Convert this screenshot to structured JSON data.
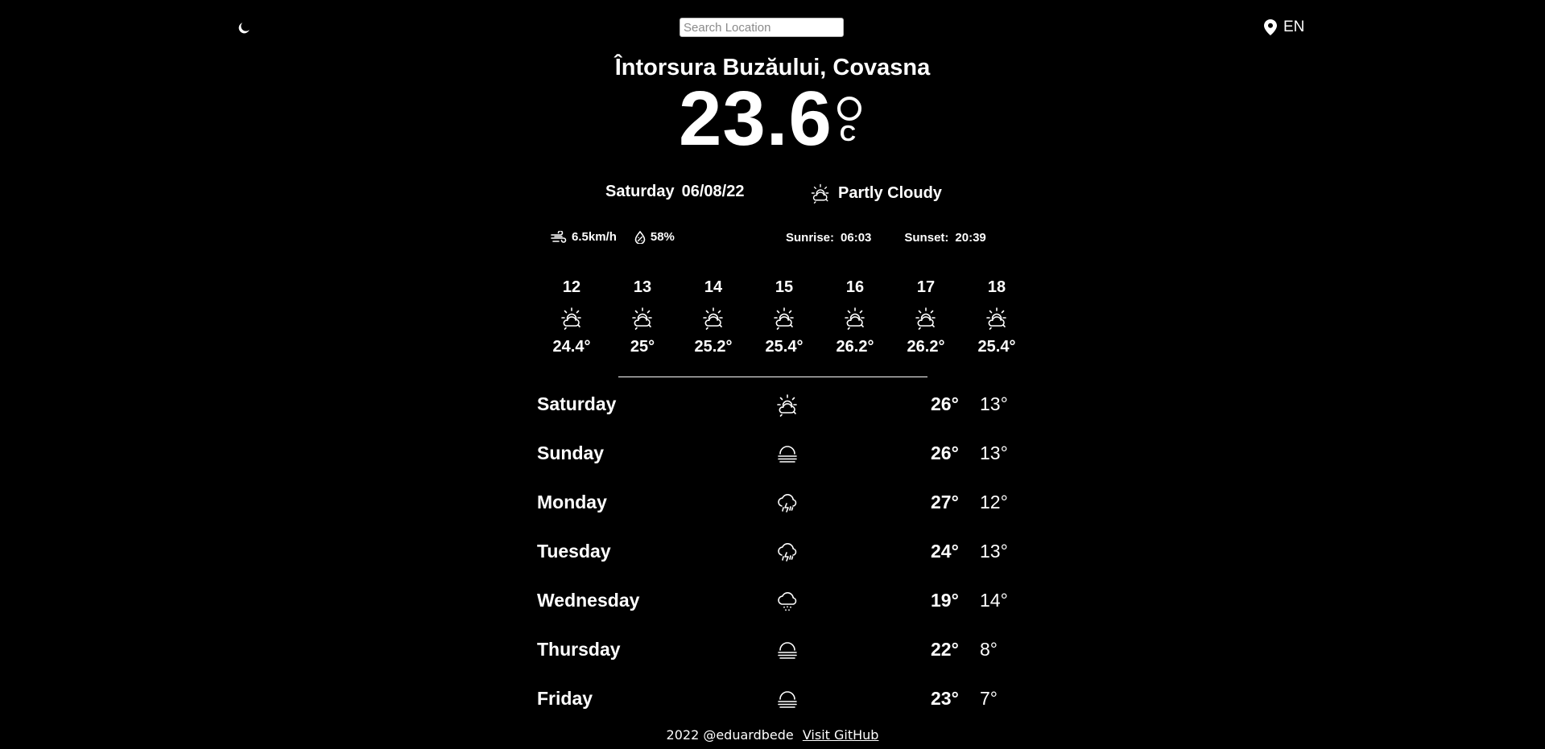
{
  "header": {
    "theme_icon": "moon-icon",
    "search_placeholder": "Search Location",
    "search_value": "",
    "locate_icon": "map-pin-icon",
    "language": "EN"
  },
  "current": {
    "location": "Întorsura Buzăului, Covasna",
    "temperature": "23.6",
    "unit": "C",
    "day": "Saturday",
    "date": "06/08/22",
    "condition_icon": "partly-cloudy-sun-icon",
    "condition": "Partly Cloudy",
    "wind_icon": "wind-icon",
    "wind": "6.5km/h",
    "humidity_icon": "humidity-drop-icon",
    "humidity": "58%",
    "sunrise_label": "Sunrise:",
    "sunrise": "06:03",
    "sunset_label": "Sunset:",
    "sunset": "20:39"
  },
  "hourly": [
    {
      "hour": "12",
      "icon": "partly-cloudy-sun-icon",
      "temp": "24.4°"
    },
    {
      "hour": "13",
      "icon": "partly-cloudy-sun-icon",
      "temp": "25°"
    },
    {
      "hour": "14",
      "icon": "partly-cloudy-sun-icon",
      "temp": "25.2°"
    },
    {
      "hour": "15",
      "icon": "partly-cloudy-sun-icon",
      "temp": "25.4°"
    },
    {
      "hour": "16",
      "icon": "partly-cloudy-sun-icon",
      "temp": "26.2°"
    },
    {
      "hour": "17",
      "icon": "partly-cloudy-sun-icon",
      "temp": "26.2°"
    },
    {
      "hour": "18",
      "icon": "partly-cloudy-sun-icon",
      "temp": "25.4°"
    }
  ],
  "daily": [
    {
      "day": "Saturday",
      "icon": "partly-cloudy-sun-icon",
      "max": "26°",
      "min": "13°"
    },
    {
      "day": "Sunday",
      "icon": "fog-icon",
      "max": "26°",
      "min": "13°"
    },
    {
      "day": "Monday",
      "icon": "thunderstorm-icon",
      "max": "27°",
      "min": "12°"
    },
    {
      "day": "Tuesday",
      "icon": "thunderstorm-icon",
      "max": "24°",
      "min": "13°"
    },
    {
      "day": "Wednesday",
      "icon": "drizzle-icon",
      "max": "19°",
      "min": "14°"
    },
    {
      "day": "Thursday",
      "icon": "fog-icon",
      "max": "22°",
      "min": "8°"
    },
    {
      "day": "Friday",
      "icon": "fog-icon",
      "max": "23°",
      "min": "7°"
    }
  ],
  "footer": {
    "credit": "2022 @eduardbede",
    "link_label": "Visit GitHub"
  }
}
